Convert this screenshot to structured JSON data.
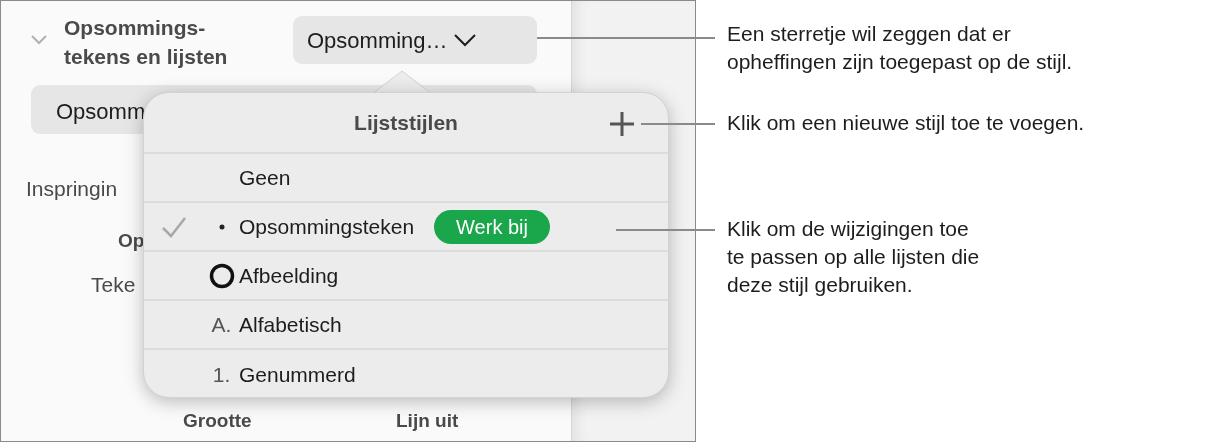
{
  "panel": {
    "section_title_lines": [
      "Opsommings-",
      "tekens en lijsten"
    ],
    "expanded": true,
    "style_dropdown": {
      "value": "Opsomming…"
    },
    "second_field": {
      "value": "Opsomm"
    },
    "labels": [
      {
        "text": "Inspringin",
        "kind": "plain"
      },
      {
        "text": "Op",
        "kind": "bold"
      },
      {
        "text": "Teke",
        "kind": "plain"
      }
    ],
    "bottom_labels": [
      "Grootte",
      "Lijn uit"
    ]
  },
  "popover": {
    "title": "Lijststijlen",
    "items": [
      {
        "label": "Geen",
        "kind": "none",
        "selected": false
      },
      {
        "label": "Opsommingsteken",
        "kind": "bullet",
        "selected": true,
        "update_button": "Werk bij"
      },
      {
        "label": "Afbeelding",
        "kind": "ring",
        "selected": false
      },
      {
        "label": "Alfabetisch",
        "kind": "text",
        "marker": "A.",
        "selected": false
      },
      {
        "label": "Genummerd",
        "kind": "text",
        "marker": "1.",
        "selected": false
      }
    ]
  },
  "callouts": [
    {
      "kind": "dropdown",
      "lines": [
        "Een sterretje wil zeggen dat er",
        "opheffingen zijn toegepast op de stijl."
      ]
    },
    {
      "kind": "add",
      "lines": [
        "Klik om een nieuwe stijl toe te voegen."
      ]
    },
    {
      "kind": "update",
      "lines": [
        "Klik om de wijzigingen toe",
        "te passen op alle lijsten die",
        "deze stijl gebruiken."
      ]
    }
  ]
}
